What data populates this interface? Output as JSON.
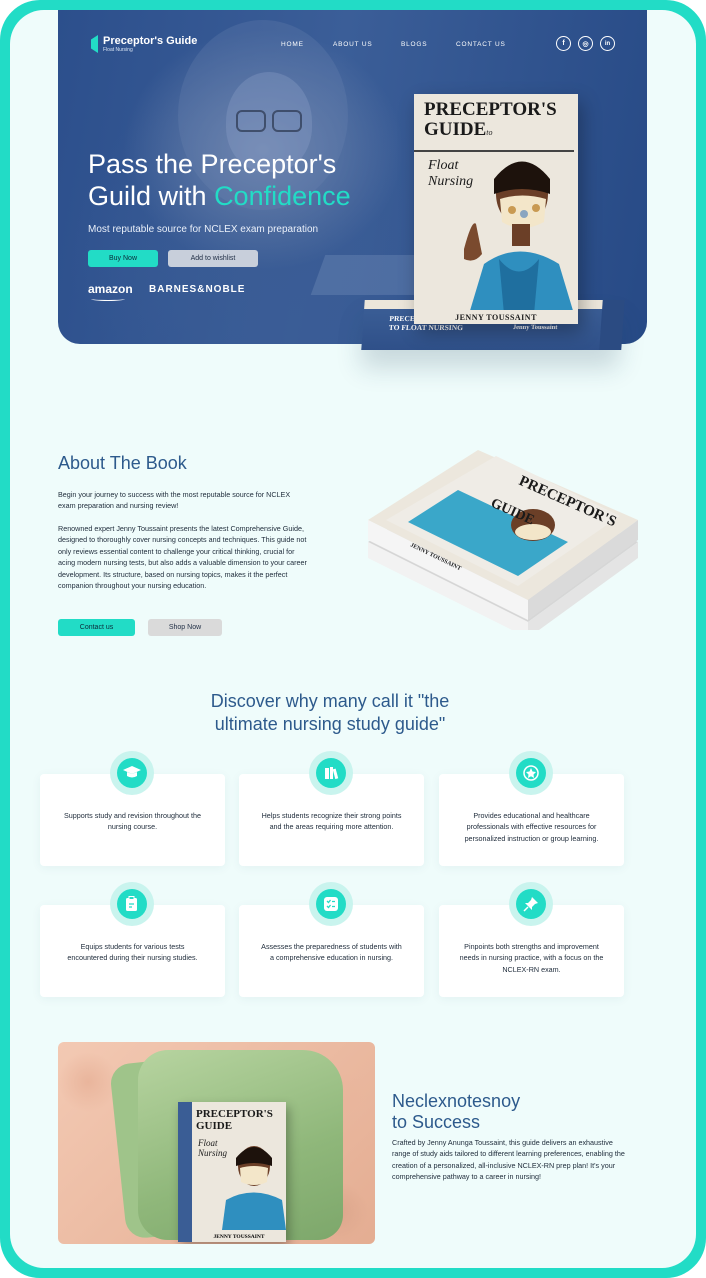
{
  "brand": {
    "title": "Preceptor's Guide",
    "subtitle": "Float Nursing"
  },
  "nav": {
    "home": "HOME",
    "about": "ABOUT US",
    "blogs": "BLOGS",
    "contact": "CONTACT US"
  },
  "social": {
    "facebook": "f",
    "instagram": "◎",
    "linkedin": "in"
  },
  "hero": {
    "title_line1": "Pass the Preceptor's",
    "title_line2_pre": "Guild with ",
    "title_line2_accent": "Confidence",
    "subtitle": "Most reputable source for NCLEX exam preparation",
    "buy_label": "Buy Now",
    "wishlist_label": "Add to wishlist",
    "retailer1": "amazon",
    "retailer2": "BARNES&NOBLE"
  },
  "book": {
    "title_line1": "PRECEPTOR'S",
    "title_line2": "GUIDE",
    "title_to": "to",
    "subtitle_line1": "Float",
    "subtitle_line2": "Nursing",
    "author": "JENNY TOUSSAINT",
    "spine_title_line1": "PRECEPTOR'S GUIDE",
    "spine_title_line2": "TO FLOAT NURSING",
    "spine_author": "Jenny Toussaint"
  },
  "about": {
    "title": "About The Book",
    "para1": "Begin your journey to success with the most reputable source for NCLEX exam preparation and nursing review!",
    "para2": "Renowned expert Jenny Toussaint presents the latest Comprehensive Guide, designed to thoroughly cover nursing concepts and techniques. This guide not only reviews essential content to challenge your critical thinking, crucial for acing modern nursing tests, but also adds a valuable dimension to your career development. Its structure, based on nursing topics, makes it the perfect companion throughout your nursing education.",
    "contact_label": "Contact us",
    "shop_label": "Shop Now"
  },
  "discover": {
    "title_line1": "Discover why many call it \"the",
    "title_line2": "ultimate nursing study guide\"",
    "cards": [
      {
        "icon": "graduation-cap-icon",
        "text": "Supports study and revision throughout the nursing course."
      },
      {
        "icon": "books-icon",
        "text": "Helps students recognize their strong points and the areas requiring more attention."
      },
      {
        "icon": "star-badge-icon",
        "text": "Provides educational and healthcare professionals with effective resources for personalized instruction or group learning."
      },
      {
        "icon": "clipboard-edit-icon",
        "text": "Equips students for various tests encountered during their nursing studies."
      },
      {
        "icon": "checklist-icon",
        "text": "Assesses the preparedness of students with a comprehensive education in nursing."
      },
      {
        "icon": "pushpin-icon",
        "text": "Pinpoints both strengths and improvement needs in nursing practice, with a focus on the NCLEX-RN exam."
      }
    ]
  },
  "success": {
    "title_line1": "Neclexnotesnoy",
    "title_line2": "to Success",
    "text": "Crafted by Jenny Anunga Toussaint, this guide delivers an exhaustive range of study aids tailored to different learning preferences, enabling the creation of a personalized, all-inclusive NCLEX-RN prep plan! It's your comprehensive pathway to a career in nursing!"
  },
  "colors": {
    "accent": "#22dcc6",
    "navy": "#2d5a8c",
    "hero_bg": "#2c4f8c"
  }
}
